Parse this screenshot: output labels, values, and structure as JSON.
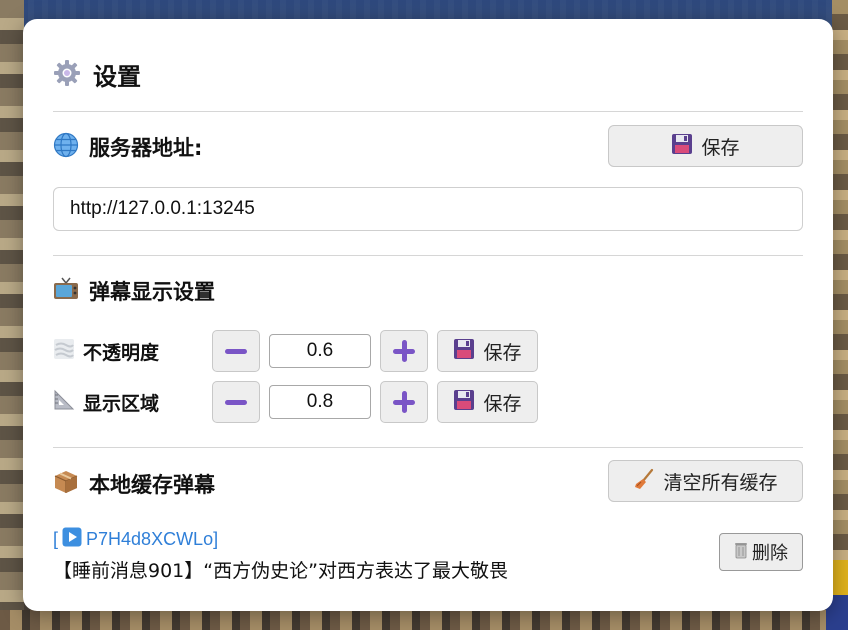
{
  "settings": {
    "title": "设置",
    "title_icon": "gear-icon",
    "server": {
      "label": "服务器地址:",
      "icon": "globe-icon",
      "save_label": "保存",
      "url_value": "http://127.0.0.1:13245"
    },
    "danmaku_display": {
      "label": "弹幕显示设置",
      "icon": "tv-icon",
      "rows": [
        {
          "label": "不透明度",
          "icon": "fog-icon",
          "value": "0.6",
          "save_label": "保存"
        },
        {
          "label": "显示区域",
          "icon": "triangle-ruler-icon",
          "value": "0.8",
          "save_label": "保存"
        }
      ]
    },
    "local_cache": {
      "label": "本地缓存弹幕",
      "icon": "package-icon",
      "clear_label": "清空所有缓存",
      "items": [
        {
          "open_bracket": "[",
          "video_id": "P7H4d8XCWLo]",
          "title": "【睡前消息901】“西方伪史论”对西方表达了最大敬畏",
          "delete_label": "删除"
        }
      ]
    }
  },
  "colors": {
    "accent_purple": "#7a55c6",
    "link_blue": "#2f7fd8",
    "panel_bg": "#ffffff",
    "button_bg": "#eeeeee"
  }
}
